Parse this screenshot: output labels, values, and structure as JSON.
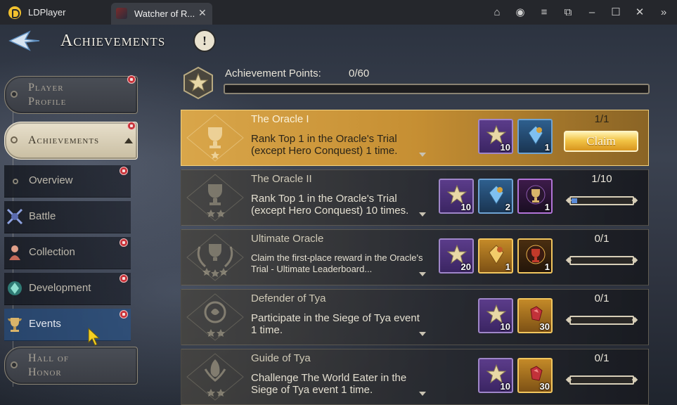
{
  "window": {
    "app_name": "LDPlayer",
    "tab_title": "Watcher of R...",
    "tab_close": "✕",
    "buttons": {
      "store": "⌂",
      "account": "◉",
      "menu": "≡",
      "popout": "⧉",
      "minimize": "–",
      "maximize": "☐",
      "close": "✕",
      "collapse": "»"
    }
  },
  "header": {
    "title": "Achievements",
    "info_label": "!"
  },
  "sidebar": {
    "main_items": [
      {
        "label_line1": "Player",
        "label_line2": "Profile",
        "badge": true
      },
      {
        "label": "Achievements",
        "badge": true,
        "active": true
      },
      {
        "label_line1": "Hall of",
        "label_line2": "Honor",
        "badge": false
      }
    ],
    "sub_items": [
      {
        "label": "Overview",
        "badge": true
      },
      {
        "label": "Battle",
        "badge": false
      },
      {
        "label": "Collection",
        "badge": true
      },
      {
        "label": "Development",
        "badge": true
      },
      {
        "label": "Events",
        "badge": true,
        "selected": true
      }
    ]
  },
  "points": {
    "label": "Achievement Points:",
    "value": "0/60",
    "progress": 0
  },
  "achievements": [
    {
      "title": "The Oracle I",
      "description": "Rank Top 1 in the Oracle's Trial (except Hero Conquest) 1 time.",
      "rewards": [
        {
          "icon": "achievement-star-icon",
          "type": "purple",
          "qty": "10"
        },
        {
          "icon": "blue-crystal-icon",
          "type": "blue",
          "qty": "1"
        }
      ],
      "progress_text": "1/1",
      "progress": 1.0,
      "claimable": true,
      "claim_label": "Claim"
    },
    {
      "title": "The Oracle II",
      "description": "Rank Top 1 in the Oracle's Trial (except Hero Conquest) 10 times.",
      "rewards": [
        {
          "icon": "achievement-star-icon",
          "type": "purple",
          "qty": "10"
        },
        {
          "icon": "blue-crystal-icon",
          "type": "blue",
          "qty": "2"
        },
        {
          "icon": "trophy-frame-icon",
          "type": "dark",
          "qty": "1"
        }
      ],
      "progress_text": "1/10",
      "progress": 0.1,
      "claimable": false
    },
    {
      "title": "Ultimate Oracle",
      "description": "Claim the first-place reward in the Oracle's Trial - Ultimate Leaderboard...",
      "rewards": [
        {
          "icon": "achievement-star-icon",
          "type": "purple",
          "qty": "20"
        },
        {
          "icon": "gold-crystal-icon",
          "type": "gold",
          "qty": "1"
        },
        {
          "icon": "gold-trophy-frame-icon",
          "type": "darkgold",
          "qty": "1"
        }
      ],
      "progress_text": "0/1",
      "progress": 0,
      "claimable": false
    },
    {
      "title": "Defender of Tya",
      "description": "Participate in the Siege of Tya event 1 time.",
      "rewards": [
        {
          "icon": "achievement-star-icon",
          "type": "purple",
          "qty": "10"
        },
        {
          "icon": "red-gem-icon",
          "type": "gold",
          "qty": "30"
        }
      ],
      "progress_text": "0/1",
      "progress": 0,
      "claimable": false
    },
    {
      "title": "Guide of Tya",
      "description": "Challenge The World Eater in the Siege of Tya event 1 time.",
      "rewards": [
        {
          "icon": "achievement-star-icon",
          "type": "purple",
          "qty": "10"
        },
        {
          "icon": "red-gem-icon",
          "type": "gold",
          "qty": "30"
        }
      ],
      "progress_text": "0/1",
      "progress": 0,
      "claimable": false
    }
  ]
}
